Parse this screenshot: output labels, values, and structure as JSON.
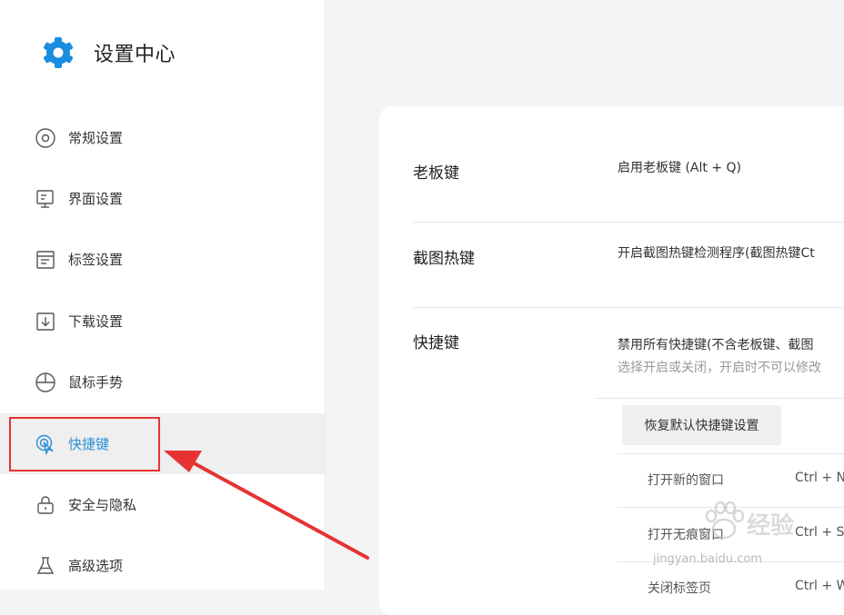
{
  "sidebar": {
    "title": "设置中心",
    "items": [
      {
        "label": "常规设置",
        "icon": "general-settings-icon"
      },
      {
        "label": "界面设置",
        "icon": "interface-settings-icon"
      },
      {
        "label": "标签设置",
        "icon": "tab-settings-icon"
      },
      {
        "label": "下载设置",
        "icon": "download-settings-icon"
      },
      {
        "label": "鼠标手势",
        "icon": "mouse-gesture-icon"
      },
      {
        "label": "快捷键",
        "icon": "shortcut-icon",
        "active": true
      },
      {
        "label": "安全与隐私",
        "icon": "lock-icon"
      },
      {
        "label": "高级选项",
        "icon": "flask-icon"
      }
    ]
  },
  "main": {
    "boss_key": {
      "title": "老板键",
      "option": "启用老板键 (Alt + Q)"
    },
    "screenshot_hotkey": {
      "title": "截图热键",
      "option": "开启截图热键检测程序(截图热键Ct"
    },
    "shortcuts": {
      "title": "快捷键",
      "option": "禁用所有快捷键(不含老板键、截图",
      "hint": "选择开启或关闭，开启时不可以修改",
      "restore_button": "恢复默认快捷键设置",
      "list": [
        {
          "action": "打开新的窗口",
          "key": "Ctrl + N"
        },
        {
          "action": "打开无痕窗口",
          "key": "Ctrl + S"
        },
        {
          "action": "关闭标签页",
          "key": "Ctrl + W"
        }
      ]
    }
  },
  "watermark": {
    "text": "经验",
    "url": "jingyan.baidu.com"
  },
  "colors": {
    "accent": "#2a8fd6",
    "brand": "#1a8de0",
    "highlight": "#e53333"
  }
}
